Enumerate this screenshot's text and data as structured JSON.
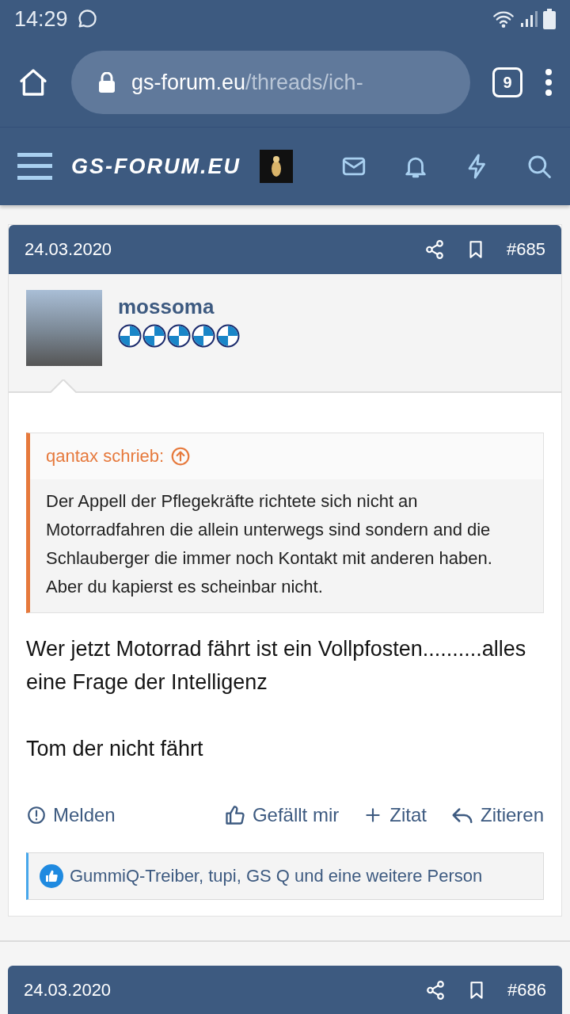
{
  "status_bar": {
    "time": "14:29"
  },
  "browser": {
    "url_host": "gs-forum.eu",
    "url_path": "/threads/ich-",
    "tab_count": "9"
  },
  "site_header": {
    "logo": "GS-FORUM.EU"
  },
  "posts": [
    {
      "date": "24.03.2020",
      "number": "#685",
      "author": "mossoma",
      "quote": {
        "author": "qantax schrieb:",
        "text": "Der Appell der Pflegekräfte richtete sich nicht an Motorradfahren die allein unterwegs sind sondern and die Schlauberger die immer noch Kontakt mit anderen haben. Aber du kapierst es scheinbar nicht."
      },
      "paragraphs": [
        "Wer jetzt Motorrad fährt ist ein Vollpfosten..........alles eine Frage der Intelligenz",
        "Tom der nicht fährt"
      ],
      "actions": [
        {
          "kind": "report",
          "label": "Melden"
        },
        {
          "kind": "like",
          "label": "Gefällt mir"
        },
        {
          "kind": "multiquote",
          "label": "Zitat"
        },
        {
          "kind": "reply",
          "label": "Zitieren"
        }
      ],
      "likes": "GummiQ-Treiber, tupi, GS Q und eine weitere Person"
    },
    {
      "date": "24.03.2020",
      "number": "#686"
    }
  ]
}
